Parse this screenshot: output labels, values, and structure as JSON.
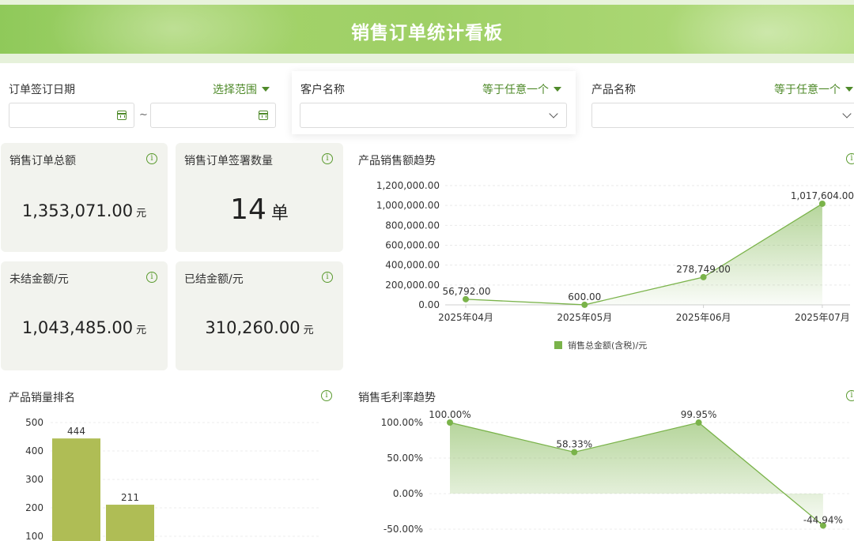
{
  "header": {
    "title": "销售订单统计看板"
  },
  "filters": {
    "date": {
      "label": "订单签订日期",
      "operator": "选择范围",
      "separator": "~"
    },
    "customer": {
      "label": "客户名称",
      "operator": "等于任意一个"
    },
    "product": {
      "label": "产品名称",
      "operator": "等于任意一个"
    }
  },
  "kpis": {
    "total_amount": {
      "label": "销售订单总额",
      "value": "1,353,071.00",
      "unit": "元"
    },
    "order_count": {
      "label": "销售订单签署数量",
      "value": "14",
      "unit": "单"
    },
    "unsettled": {
      "label": "未结金额/元",
      "value": "1,043,485.00",
      "unit": "元"
    },
    "settled": {
      "label": "已结金额/元",
      "value": "310,260.00",
      "unit": "元"
    }
  },
  "panels": {
    "sales_trend": {
      "title": "产品销售额趋势"
    },
    "ranking": {
      "title": "产品销量排名"
    },
    "margin_trend": {
      "title": "销售毛利率趋势"
    }
  },
  "colors": {
    "accent": "#5a9a2e",
    "line": "#7ab34a",
    "bar": "#afbd55",
    "card": "#f2f3ee"
  },
  "chart_data": [
    {
      "type": "area",
      "title": "产品销售额趋势",
      "categories": [
        "2025年04月",
        "2025年05月",
        "2025年06月",
        "2025年07月"
      ],
      "series": [
        {
          "name": "销售总金额(含税)/元",
          "values": [
            56792.0,
            600.0,
            278749.0,
            1017604.0
          ]
        }
      ],
      "data_labels": [
        "56,792.00",
        "600.00",
        "278,749.00",
        "1,017,604.00"
      ],
      "yticks": [
        "0.00",
        "200,000.00",
        "400,000.00",
        "600,000.00",
        "800,000.00",
        "1,000,000.00",
        "1,200,000.00"
      ],
      "ylim": [
        0,
        1200000
      ],
      "legend": "bottom-center"
    },
    {
      "type": "bar",
      "title": "产品销量排名",
      "values": [
        444,
        211
      ],
      "data_labels": [
        "444",
        "211"
      ],
      "yticks": [
        "100",
        "200",
        "300",
        "400",
        "500"
      ],
      "ylim": [
        0,
        500
      ]
    },
    {
      "type": "area",
      "title": "销售毛利率趋势",
      "values": [
        100.0,
        58.33,
        99.95,
        -44.94
      ],
      "data_labels": [
        "100.00%",
        "58.33%",
        "99.95%",
        "-44.94%"
      ],
      "yticks": [
        "-50.00%",
        "0.00%",
        "50.00%",
        "100.00%"
      ],
      "ylim": [
        -50,
        100
      ]
    }
  ]
}
